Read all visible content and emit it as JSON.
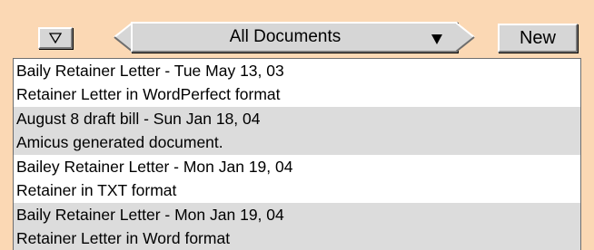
{
  "toolbar": {
    "filter_icon": "triangle-down-icon",
    "nav_prev_icon": "chevron-left-icon",
    "nav_next_icon": "chevron-right-icon",
    "selector": {
      "selected": "All Documents",
      "arrow_icon": "dropdown-arrow-icon"
    },
    "new_label": "New"
  },
  "documents": [
    {
      "title": "Baily Retainer Letter - Tue May 13, 03",
      "description": "Retainer Letter in WordPerfect format"
    },
    {
      "title": "August 8 draft bill - Sun Jan 18, 04",
      "description": "Amicus generated document."
    },
    {
      "title": "Bailey Retainer Letter - Mon Jan 19, 04",
      "description": "Retainer in TXT format"
    },
    {
      "title": "Baily Retainer Letter - Mon Jan 19, 04",
      "description": "Retainer Letter in Word format"
    }
  ],
  "colors": {
    "background": "#fbd8b4",
    "button_face": "#d6d6d6",
    "row_alt": "#dcdcdc",
    "row_base": "#ffffff"
  }
}
